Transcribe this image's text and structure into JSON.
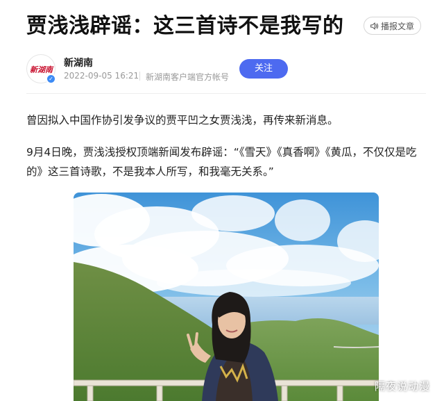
{
  "article": {
    "title": "贾浅浅辟谣：这三首诗不是我写的",
    "audio_button_label": "播报文章"
  },
  "author": {
    "name": "新湖南",
    "logo_text": "新湖南",
    "verified": true,
    "publish_time": "2022-09-05 16:21",
    "account_description": "新湖南客户端官方帐号",
    "follow_label": "关注"
  },
  "body": {
    "paragraphs": [
      "曾因拟入中国作协引发争议的贾平凹之女贾浅浅，再传来新消息。",
      "9月4日晚，贾浅浅授权顶端新闻发布辟谣：“《雪天》《真香啊》《黄瓜，不仅仅是吃的》这三首诗歌，不是我本人所写，和我毫无关系。”"
    ]
  },
  "image": {
    "watermark": "隔夜说动漫"
  },
  "colors": {
    "accent": "#4d6af0",
    "verify_badge": "#3d8bf5",
    "meta_text": "#999999",
    "logo_red": "#c8102e"
  },
  "icons": {
    "audio": "speaker-icon",
    "verified": "verified-badge-icon"
  }
}
